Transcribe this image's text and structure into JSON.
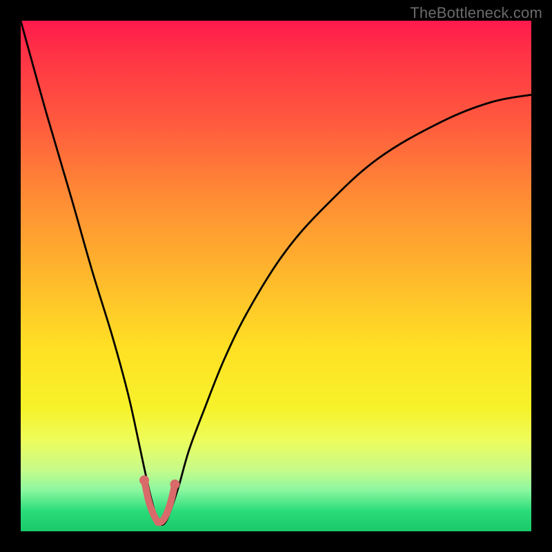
{
  "watermark": {
    "label": "TheBottleneck.com"
  },
  "chart_data": {
    "type": "line",
    "title": "",
    "xlabel": "",
    "ylabel": "",
    "xlim": [
      0,
      100
    ],
    "ylim": [
      0,
      100
    ],
    "grid": false,
    "series": [
      {
        "name": "curve",
        "x": [
          0,
          5,
          10,
          14,
          18,
          21,
          23,
          24.5,
          25.8,
          27.0,
          28.2,
          29.5,
          31,
          33,
          36,
          40,
          45,
          52,
          60,
          70,
          82,
          92,
          100
        ],
        "y": [
          100,
          82,
          65,
          51,
          38,
          27,
          18,
          11,
          5.5,
          1.8,
          1.6,
          4.5,
          9,
          16,
          24,
          34,
          44,
          55,
          64,
          73,
          80,
          84,
          85.5
        ]
      }
    ],
    "highlight": {
      "description": "near-minimum region rendered with thick muted-red stroke and endpoint dots",
      "color": "#d86a6a",
      "x": [
        24.2,
        25.0,
        25.8,
        26.6,
        27.0,
        27.8,
        28.6,
        29.4,
        30.2
      ],
      "y": [
        10.0,
        6.2,
        3.8,
        2.2,
        1.7,
        2.1,
        3.5,
        5.8,
        9.2
      ]
    }
  }
}
